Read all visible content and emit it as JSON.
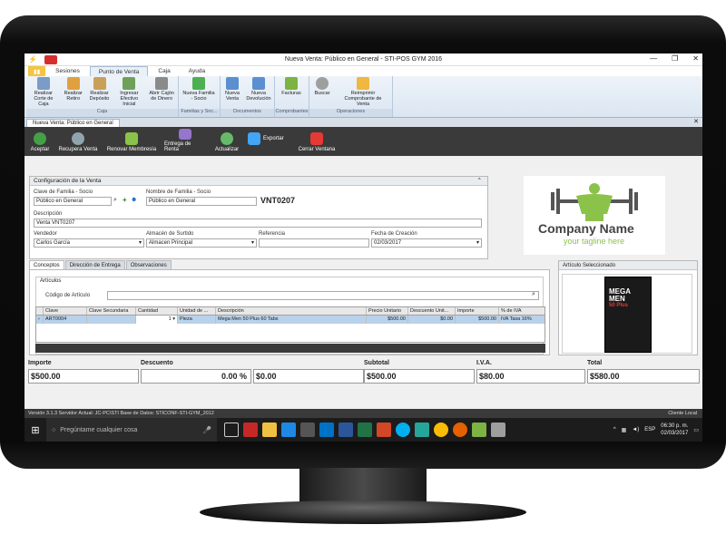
{
  "window": {
    "title": "Nueva Venta: Público en General - STI-POS GYM 2016"
  },
  "menu_tabs": [
    {
      "label": "Sesiones"
    },
    {
      "label": "Punto de Venta"
    },
    {
      "label": "Caja"
    },
    {
      "label": "Ayuda"
    }
  ],
  "ribbon": {
    "groups": [
      {
        "name": "Caja",
        "buttons": [
          "Realizar Corte de Caja",
          "Realizar Retiro",
          "Realizar Depósito",
          "Ingresar Efectivo Inicial",
          "Abrir Cajón de Dinero"
        ]
      },
      {
        "name": "Familias y Soc...",
        "buttons": [
          "Nueva Familia - Socio"
        ]
      },
      {
        "name": "Documentos",
        "buttons": [
          "Nueva Venta",
          "Nueva Devolución"
        ]
      },
      {
        "name": "Comprobantes",
        "buttons": [
          "Facturas"
        ]
      },
      {
        "name": "Operaciones",
        "buttons": [
          "Buscar",
          "Reimprimir Comprobante de Venta"
        ]
      }
    ]
  },
  "doc_tab": {
    "label": "Nueva Venta: Público en General"
  },
  "toolbar": {
    "accept": "Aceptar",
    "recover": "Recupera Venta",
    "renew": "Renovar Membresía",
    "rental": "Entrega de Renta",
    "update": "Actualizar",
    "export": "Exportar",
    "close": "Cerrar Ventana"
  },
  "config": {
    "title": "Configuración de la Venta",
    "family_key_label": "Clave de Familia - Socio",
    "family_key_value": "Público en General",
    "family_name_label": "Nombre de Familia - Socio",
    "family_name_value": "Público en General",
    "folio": "VNT0207",
    "description_label": "Descripción",
    "description_value": "Venta VNT0207",
    "seller_label": "Vendedor",
    "seller_value": "Carlos  García",
    "warehouse_label": "Almacén de Surtido",
    "warehouse_value": "Almacen Principal",
    "reference_label": "Referencia",
    "reference_value": "",
    "date_label": "Fecha de Creación",
    "date_value": "02/03/2017"
  },
  "logo": {
    "name": "Company Name",
    "tagline": "your tagline here"
  },
  "sub_tabs": [
    {
      "label": "Conceptos"
    },
    {
      "label": "Dirección de Entrega"
    },
    {
      "label": "Observaciones"
    }
  ],
  "articles": {
    "group_title": "Artículos",
    "code_label": "Código de Artículo",
    "code_value": "",
    "columns": [
      "Clave",
      "Clave Secundaria",
      "Cantidad",
      "Unidad de ...",
      "Descripción",
      "Precio Unitario",
      "Descuento Unit...",
      "Importe",
      "% de IVA"
    ],
    "rows": [
      {
        "clave": "ART0004",
        "clave2": "",
        "cantidad": "1",
        "unidad": "Pieza",
        "descripcion": "Mega Men 50 Plus 60 Tabs",
        "precio": "$500.00",
        "descuento": "$0.00",
        "importe": "$500.00",
        "iva": "IVA Tasa 16%"
      }
    ]
  },
  "selected_article": {
    "title": "Artículo Seleccionado",
    "product_line1": "MEGA",
    "product_line2": "MEN",
    "product_line3": "50 Plus"
  },
  "totals": {
    "importe_label": "Importe",
    "importe": "$500.00",
    "descuento_label": "Descuento",
    "descuento_pct": "0.00 %",
    "descuento": "$0.00",
    "subtotal_label": "Subtotal",
    "subtotal": "$500.00",
    "iva_label": "I.V.A.",
    "iva": "$80.00",
    "total_label": "Total",
    "total": "$580.00"
  },
  "status": {
    "left": "Versión 3.1.3   Servidor Actual: JC-PC\\STI   Base de Datos: STICONF-STI-GYM_2012",
    "right": "Cliente Local"
  },
  "taskbar": {
    "search_placeholder": "Pregúntame cualquier cosa",
    "lang": "ESP",
    "time": "06:30 p. m.",
    "date": "02/03/2017"
  }
}
